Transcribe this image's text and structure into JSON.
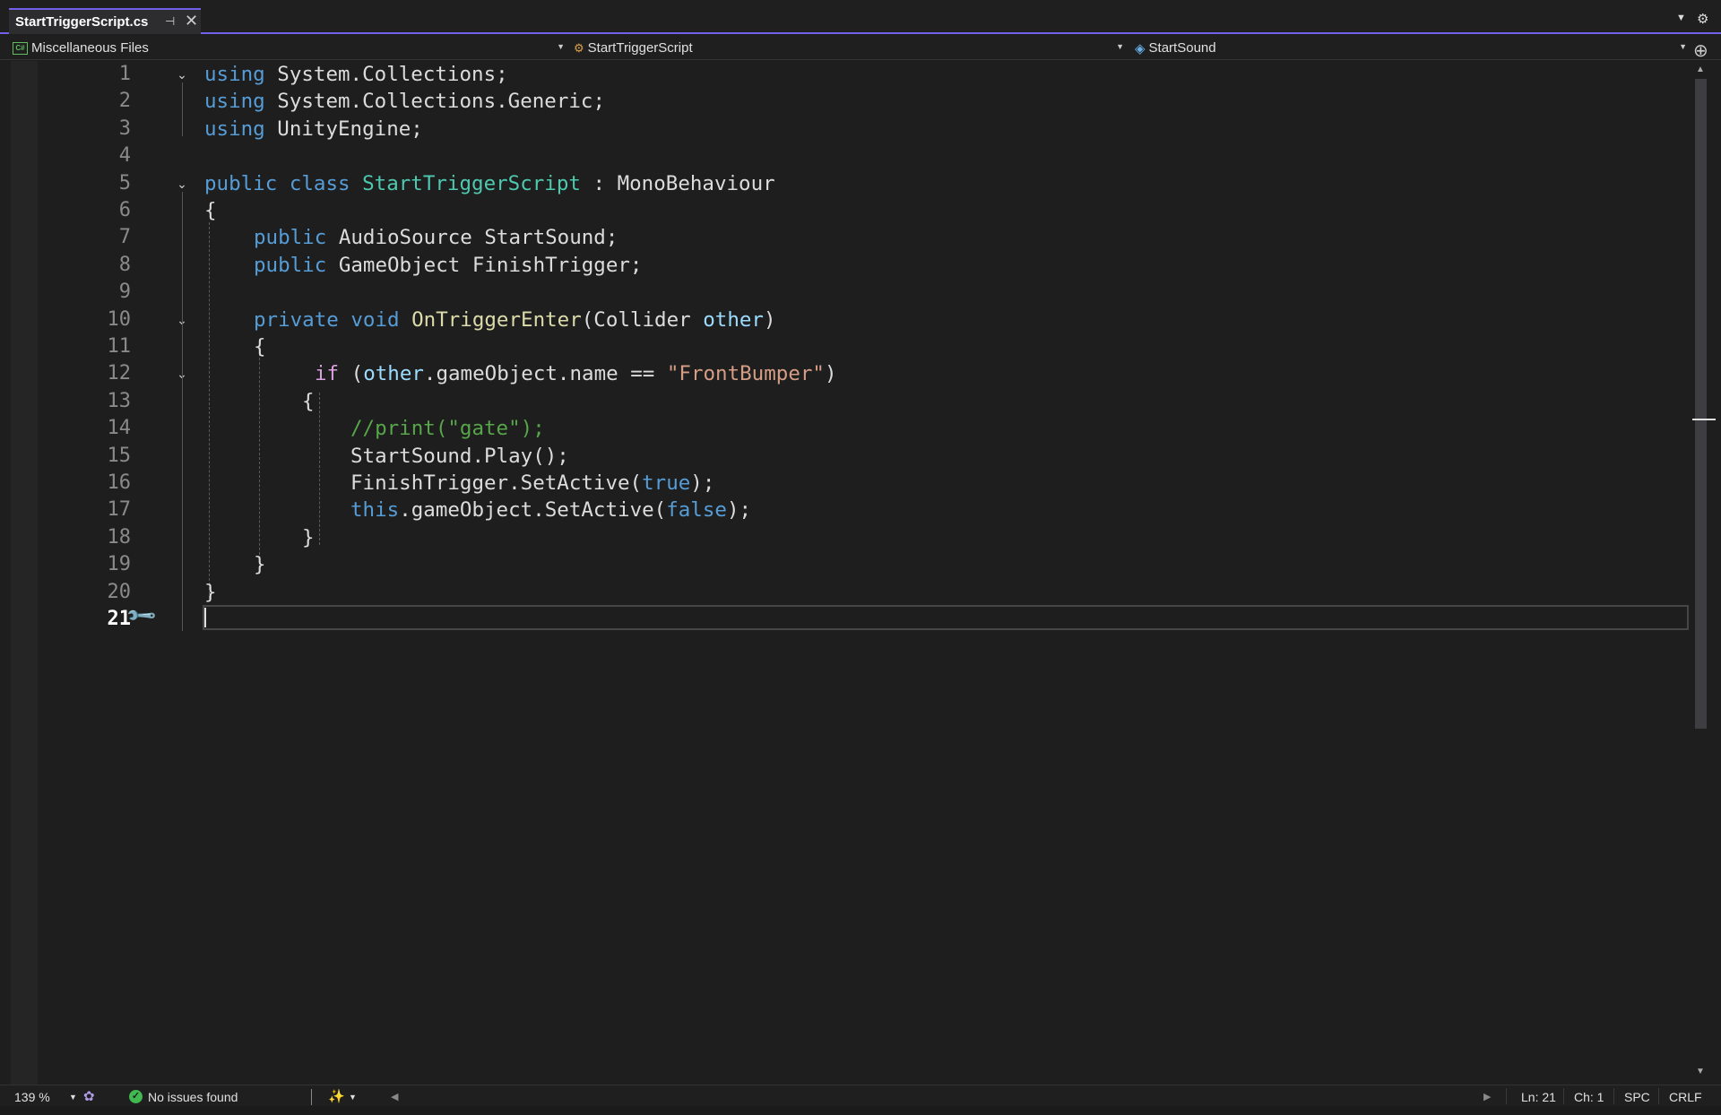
{
  "tab": {
    "title": "StartTriggerScript.cs",
    "pin_icon": "pin-icon",
    "close_icon": "close-icon"
  },
  "nav": {
    "project": "Miscellaneous Files",
    "type": "StartTriggerScript",
    "member": "StartSound"
  },
  "line_numbers": [
    "1",
    "2",
    "3",
    "4",
    "5",
    "6",
    "7",
    "8",
    "9",
    "10",
    "11",
    "12",
    "13",
    "14",
    "15",
    "16",
    "17",
    "18",
    "19",
    "20",
    "21"
  ],
  "code": {
    "l1_kw": "using",
    "l1_rest": " System.Collections;",
    "l2_kw": "using",
    "l2_rest": " System.Collections.Generic;",
    "l3_kw": "using",
    "l3_rest": " UnityEngine;",
    "l5_public": "public",
    "l5_class": " class ",
    "l5_name": "StartTriggerScript",
    "l5_rest": " : MonoBehaviour",
    "l6": "{",
    "l7_kw": "public",
    "l7_rest": " AudioSource StartSound;",
    "l8_kw": "public",
    "l8_rest": " GameObject FinishTrigger;",
    "l10_private": "private",
    "l10_void": " void ",
    "l10_method": "OnTriggerEnter",
    "l10_open": "(Collider ",
    "l10_param": "other",
    "l10_close": ")",
    "l11": "{",
    "l12_if": "if",
    "l12_open": " (",
    "l12_other": "other",
    "l12_mid": ".gameObject.name == ",
    "l12_str": "\"FrontBumper\"",
    "l12_close": ")",
    "l13": "{",
    "l14": "//print(\"gate\");",
    "l15": "StartSound.Play();",
    "l16_a": "FinishTrigger.SetActive(",
    "l16_kw": "true",
    "l16_b": ");",
    "l17_this": "this",
    "l17_a": ".gameObject.SetActive(",
    "l17_kw": "false",
    "l17_b": ");",
    "l18": "}",
    "l19": "}",
    "l20": "}"
  },
  "status": {
    "zoom": "139 %",
    "issues": "No issues found",
    "ln": "Ln: 21",
    "ch": "Ch: 1",
    "spc": "SPC",
    "crlf": "CRLF"
  },
  "colors": {
    "accent": "#7160e8",
    "keyword": "#569cd6",
    "type": "#4ec9b0",
    "method": "#dcdcaa",
    "parameter": "#9cdcfe",
    "string": "#d69d85",
    "comment": "#57a64a",
    "control": "#d8a0df"
  }
}
